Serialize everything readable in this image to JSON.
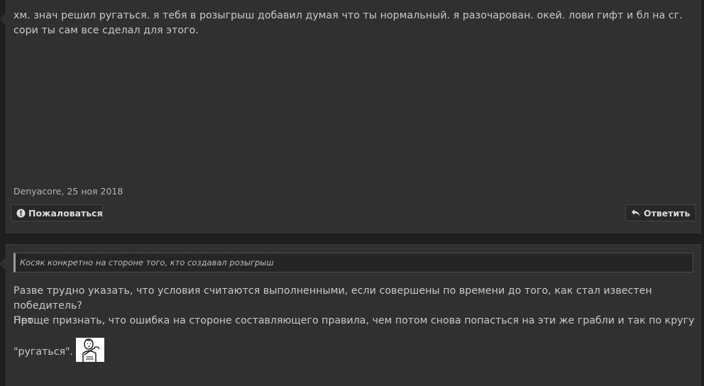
{
  "post1": {
    "text": "хм. знач решил ругаться. я тебя в розыгрыш добавил думая что ты нормальный. я разочарован. окей. лови гифт и бл на сг. сори ты сам все сделал для этого.",
    "author": "Denyacore",
    "date": "25 ноя 2018",
    "report_label": "Пожаловаться",
    "reply_label": "Ответить"
  },
  "post2": {
    "quote": "Косяк конкретно на стороне того, кто создавал розыгрыш",
    "line1": "Разве трудно указать, что условия считаются выполненными, если совершены по времени до того, как стал известен победитель?",
    "line2": "Нет.",
    "line3": "Проще признать, что ошибка на стороне составляющего правила, чем потом снова попасться на эти же грабли и так по кругу",
    "line4": "\"ругаться\"."
  },
  "icons": {
    "report": "exclamation-circle-icon",
    "reply": "reply-arrow-icon",
    "emoji": "facepalm-meme-emoji"
  },
  "colors": {
    "background": "#1f1f1f",
    "post_bg": "#303030",
    "text": "#c9c9c9"
  }
}
